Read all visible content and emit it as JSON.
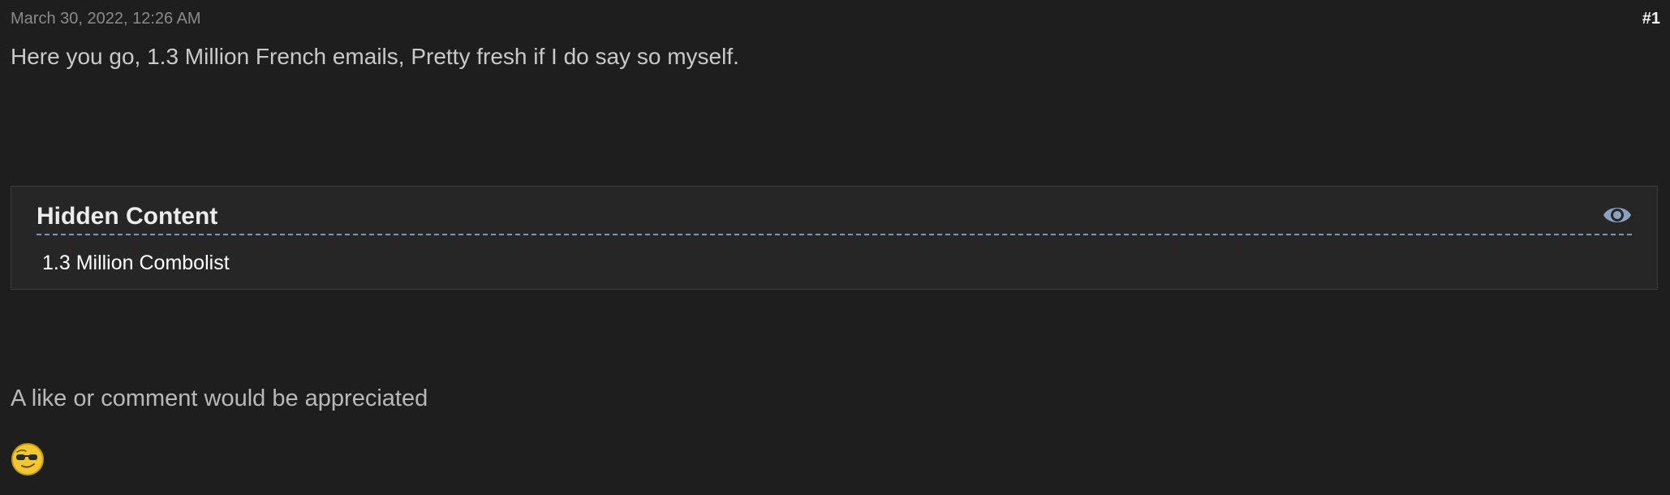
{
  "post": {
    "date": "March 30, 2022, 12:26 AM",
    "number": "#1",
    "body_text": "Here you go, 1.3 Million French emails, Pretty fresh if I do say so myself.",
    "hidden_content": {
      "title": "Hidden Content",
      "text": "1.3 Million Combolist",
      "icon": "eye-icon"
    },
    "appreciation_text": "A like or comment would be appreciated",
    "emoji": "cool-smiley-emoji"
  },
  "colors": {
    "background": "#1e1e1e",
    "box_background": "#262626",
    "accent_dashed": "#7f97b3",
    "eye_icon": "#8aa2c0",
    "emoji_yellow": "#f2c832"
  }
}
